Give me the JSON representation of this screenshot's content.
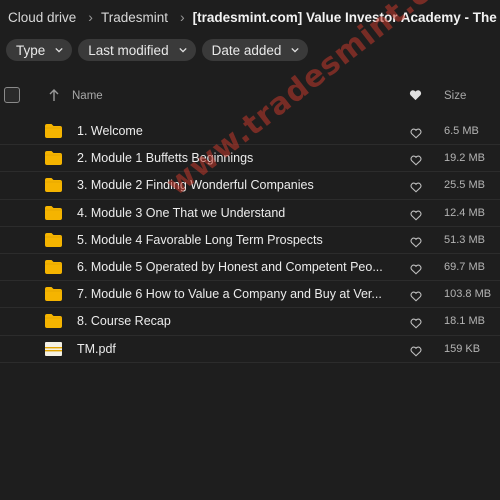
{
  "breadcrumb": {
    "items": [
      "Cloud drive",
      "Tradesmint",
      "[tradesmint.com] Value Investor Academy - The Warr"
    ]
  },
  "filters": [
    {
      "label": "Type"
    },
    {
      "label": "Last modified"
    },
    {
      "label": "Date added"
    }
  ],
  "table": {
    "columns": {
      "name": "Name",
      "size": "Size"
    },
    "rows": [
      {
        "name": "1. Welcome",
        "size": "6.5 MB",
        "type": "folder"
      },
      {
        "name": "2. Module 1 Buffetts Beginnings",
        "size": "19.2 MB",
        "type": "folder"
      },
      {
        "name": "3. Module 2 Finding Wonderful Companies",
        "size": "25.5 MB",
        "type": "folder"
      },
      {
        "name": "4. Module 3 One That we Understand",
        "size": "12.4 MB",
        "type": "folder"
      },
      {
        "name": "5. Module 4 Favorable Long Term Prospects",
        "size": "51.3 MB",
        "type": "folder"
      },
      {
        "name": "6. Module 5 Operated by Honest and Competent Peo...",
        "size": "69.7 MB",
        "type": "folder"
      },
      {
        "name": "7. Module 6 How to Value a Company and Buy at Ver...",
        "size": "103.8 MB",
        "type": "folder"
      },
      {
        "name": "8. Course Recap",
        "size": "18.1 MB",
        "type": "folder"
      },
      {
        "name": "TM.pdf",
        "size": "159 KB",
        "type": "pdf"
      }
    ]
  },
  "watermark": "www.tradesmint.com",
  "colors": {
    "background": "#1e1e1e",
    "folder": "#f5b400",
    "pill": "#3a3a3a",
    "watermark": "#c0392b"
  },
  "icons": {
    "folder": "folder-icon",
    "pdf": "pdf-file-icon",
    "favorite": "heart-icon",
    "sort": "arrow-up-icon",
    "chevron": "chevron-down-icon"
  }
}
